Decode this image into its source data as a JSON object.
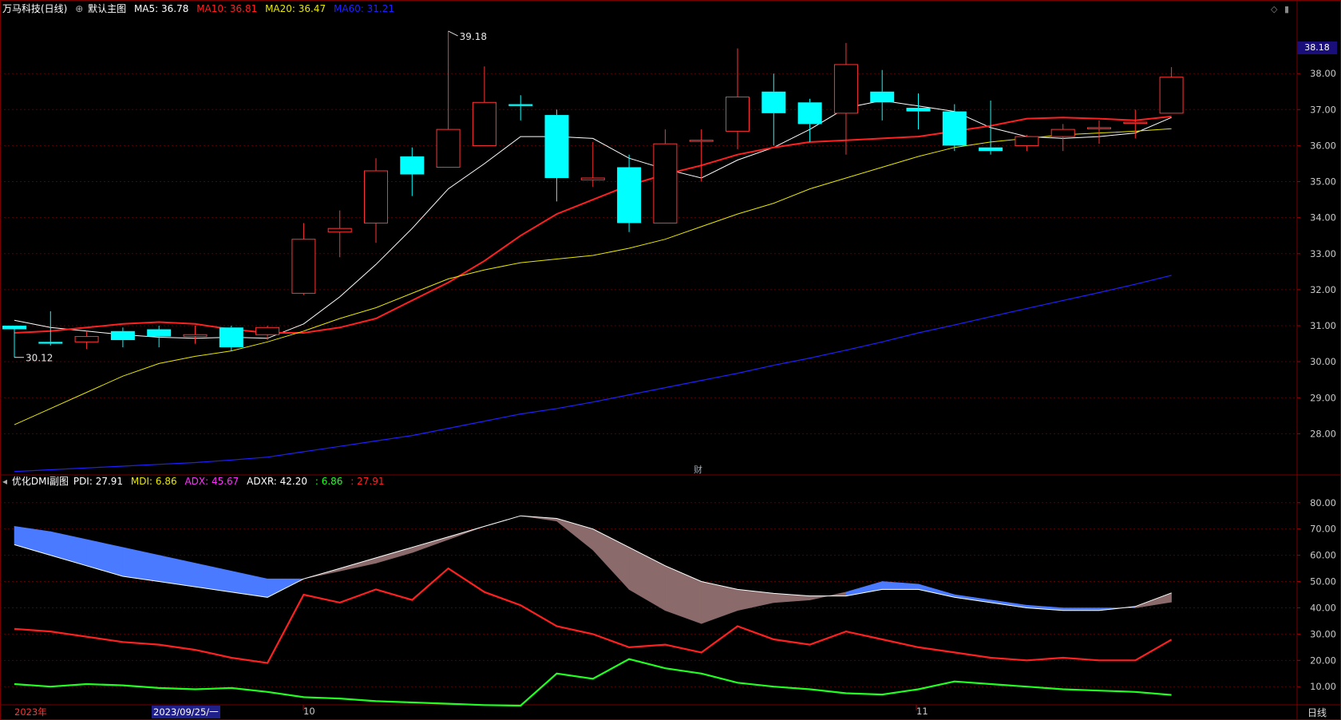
{
  "main_header": {
    "title": "万马科技(日线)",
    "indicator_name": "默认主图",
    "ma5": "MA5: 36.78",
    "ma10": "MA10: 36.81",
    "ma20": "MA20: 36.47",
    "ma60": "MA60: 31.21"
  },
  "sub_header": {
    "indicator_name": "优化DMI副图",
    "pdi": "PDI: 27.91",
    "mdi": "MDI: 6.86",
    "adx": "ADX: 45.67",
    "adxr": "ADXR: 42.20",
    "extra1": ": 6.86",
    "extra2": ": 27.91"
  },
  "current_price_label": "38.18",
  "finance_marker": "财",
  "x_axis": {
    "year_label": "2023年",
    "cursor_date": "2023/09/25/一",
    "month_10": "10",
    "month_11": "11",
    "period_button": "日线"
  },
  "colors": {
    "background": "#000000",
    "up": "#ff3333",
    "down": "#00ffff",
    "ma5": "#ffffff",
    "ma10": "#ff2020",
    "ma20": "#e8e800",
    "ma60": "#2020ff",
    "pdi": "#ff2020",
    "mdi": "#20ff20",
    "adx_fill_up": "#8a6a6a",
    "adx_fill_down": "#4a7aff",
    "grid": "#5a0000"
  },
  "chart_data": [
    {
      "type": "candlestick",
      "title": "万马科技(日线)",
      "y_range": [
        26.9,
        39.6
      ],
      "y_ticks": [
        "38.00",
        "37.00",
        "36.00",
        "35.00",
        "34.00",
        "33.00",
        "32.00",
        "31.00",
        "30.00",
        "29.00",
        "28.00"
      ],
      "annotations": [
        {
          "text": "39.18",
          "kind": "high",
          "index": 12
        },
        {
          "text": "30.12",
          "kind": "low",
          "index": 0
        }
      ],
      "candles": [
        {
          "open": 31.0,
          "high": 31.0,
          "low": 30.12,
          "close": 30.9
        },
        {
          "open": 30.55,
          "high": 31.4,
          "low": 30.45,
          "close": 30.5
        },
        {
          "open": 30.55,
          "high": 30.85,
          "low": 30.35,
          "close": 30.7
        },
        {
          "open": 30.85,
          "high": 30.95,
          "low": 30.4,
          "close": 30.6
        },
        {
          "open": 30.9,
          "high": 31.0,
          "low": 30.4,
          "close": 30.7
        },
        {
          "open": 30.7,
          "high": 31.0,
          "low": 30.5,
          "close": 30.75
        },
        {
          "open": 30.95,
          "high": 31.0,
          "low": 30.3,
          "close": 30.4
        },
        {
          "open": 30.75,
          "high": 31.0,
          "low": 30.6,
          "close": 30.95
        },
        {
          "open": 31.9,
          "high": 33.85,
          "low": 31.85,
          "close": 33.4
        },
        {
          "open": 33.6,
          "high": 34.2,
          "low": 32.9,
          "close": 33.7
        },
        {
          "open": 33.85,
          "high": 35.65,
          "low": 33.3,
          "close": 35.3
        },
        {
          "open": 35.7,
          "high": 35.95,
          "low": 34.6,
          "close": 35.2
        },
        {
          "open": 35.4,
          "high": 39.18,
          "low": 35.4,
          "close": 36.45
        },
        {
          "open": 36.0,
          "high": 38.2,
          "low": 36.0,
          "close": 37.2
        },
        {
          "open": 37.15,
          "high": 37.4,
          "low": 36.7,
          "close": 37.1
        },
        {
          "open": 36.85,
          "high": 37.0,
          "low": 34.45,
          "close": 35.1
        },
        {
          "open": 35.05,
          "high": 36.1,
          "low": 34.85,
          "close": 35.1
        },
        {
          "open": 35.4,
          "high": 35.75,
          "low": 33.6,
          "close": 33.85
        },
        {
          "open": 33.85,
          "high": 36.45,
          "low": 33.85,
          "close": 36.05
        },
        {
          "open": 36.15,
          "high": 36.45,
          "low": 35.0,
          "close": 36.15
        },
        {
          "open": 36.4,
          "high": 38.7,
          "low": 35.9,
          "close": 37.35
        },
        {
          "open": 37.5,
          "high": 38.0,
          "low": 36.0,
          "close": 36.9
        },
        {
          "open": 37.2,
          "high": 37.3,
          "low": 36.1,
          "close": 36.6
        },
        {
          "open": 36.9,
          "high": 38.85,
          "low": 35.75,
          "close": 38.25
        },
        {
          "open": 37.5,
          "high": 38.1,
          "low": 36.7,
          "close": 37.2
        },
        {
          "open": 37.05,
          "high": 37.45,
          "low": 36.45,
          "close": 36.95
        },
        {
          "open": 36.95,
          "high": 37.15,
          "low": 35.85,
          "close": 36.0
        },
        {
          "open": 35.95,
          "high": 37.25,
          "low": 35.75,
          "close": 35.85
        },
        {
          "open": 36.0,
          "high": 36.3,
          "low": 35.85,
          "close": 36.25
        },
        {
          "open": 36.25,
          "high": 36.6,
          "low": 35.85,
          "close": 36.45
        },
        {
          "open": 36.5,
          "high": 36.7,
          "low": 36.05,
          "close": 36.5
        },
        {
          "open": 36.65,
          "high": 37.0,
          "low": 36.2,
          "close": 36.65
        },
        {
          "open": 36.9,
          "high": 38.18,
          "low": 36.9,
          "close": 37.9
        }
      ],
      "series": [
        {
          "name": "MA5",
          "values": [
            31.15,
            30.95,
            30.85,
            30.75,
            30.68,
            30.65,
            30.68,
            30.65,
            31.05,
            31.8,
            32.7,
            33.7,
            34.8,
            35.5,
            36.25,
            36.25,
            36.2,
            35.65,
            35.35,
            35.1,
            35.6,
            35.95,
            36.45,
            37.05,
            37.25,
            37.1,
            36.95,
            36.5,
            36.25,
            36.2,
            36.25,
            36.35,
            36.78
          ]
        },
        {
          "name": "MA10",
          "values": [
            30.8,
            30.85,
            30.95,
            31.05,
            31.1,
            31.05,
            30.9,
            30.8,
            30.8,
            30.95,
            31.2,
            31.7,
            32.2,
            32.8,
            33.5,
            34.1,
            34.5,
            34.9,
            35.2,
            35.45,
            35.75,
            35.95,
            36.1,
            36.15,
            36.2,
            36.25,
            36.4,
            36.55,
            36.75,
            36.78,
            36.75,
            36.7,
            36.81
          ]
        },
        {
          "name": "MA20",
          "values": [
            28.25,
            28.7,
            29.15,
            29.6,
            29.95,
            30.15,
            30.3,
            30.55,
            30.85,
            31.2,
            31.5,
            31.9,
            32.3,
            32.55,
            32.75,
            32.85,
            32.95,
            33.15,
            33.4,
            33.75,
            34.1,
            34.4,
            34.8,
            35.1,
            35.4,
            35.7,
            35.95,
            36.1,
            36.2,
            36.3,
            36.35,
            36.4,
            36.47
          ]
        },
        {
          "name": "MA60",
          "values": [
            26.95,
            27.0,
            27.05,
            27.1,
            27.15,
            27.2,
            27.27,
            27.35,
            27.5,
            27.65,
            27.8,
            27.95,
            28.15,
            28.35,
            28.55,
            28.7,
            28.88,
            29.08,
            29.28,
            29.48,
            29.68,
            29.9,
            30.1,
            30.32,
            30.55,
            30.8,
            31.02,
            31.25,
            31.48,
            31.7,
            31.92,
            32.15,
            32.4
          ]
        }
      ]
    },
    {
      "type": "line",
      "title": "优化DMI副图",
      "y_range": [
        4,
        86
      ],
      "y_ticks": [
        "80.00",
        "70.00",
        "60.00",
        "50.00",
        "40.00",
        "30.00",
        "20.00",
        "10.00"
      ],
      "series": [
        {
          "name": "PDI",
          "values": [
            32,
            31,
            29,
            27,
            26,
            24,
            21,
            19,
            45,
            42,
            47,
            43,
            55,
            46,
            41,
            33,
            30,
            25,
            26,
            23,
            33,
            28,
            26,
            31,
            28,
            25,
            23,
            21,
            20,
            21,
            20,
            20,
            27.91
          ]
        },
        {
          "name": "MDI",
          "values": [
            11,
            10,
            11,
            10.5,
            9.5,
            9,
            9.5,
            8,
            6,
            5.5,
            4.5,
            4,
            3.5,
            3,
            2.8,
            15,
            13,
            20.5,
            17,
            15,
            11.5,
            10,
            9,
            7.5,
            7,
            9,
            12,
            11,
            10,
            9,
            8.5,
            8,
            6.86
          ]
        },
        {
          "name": "ADX",
          "values": [
            64,
            60,
            56,
            52,
            50,
            48,
            46,
            44,
            51,
            55,
            59,
            63,
            67,
            71,
            75,
            74,
            70,
            63,
            56,
            50,
            47,
            45.5,
            44.5,
            44.5,
            47,
            47,
            44,
            42,
            40,
            39,
            39,
            40.5,
            45.67
          ]
        },
        {
          "name": "ADXR",
          "values": [
            71,
            69,
            66,
            63,
            60,
            57,
            54,
            51,
            51,
            54,
            57,
            61,
            66,
            71,
            75,
            73,
            62,
            47,
            39,
            34,
            39,
            42,
            43,
            46,
            50,
            49,
            45,
            43,
            41,
            40,
            40,
            40,
            42.2
          ]
        }
      ]
    }
  ]
}
